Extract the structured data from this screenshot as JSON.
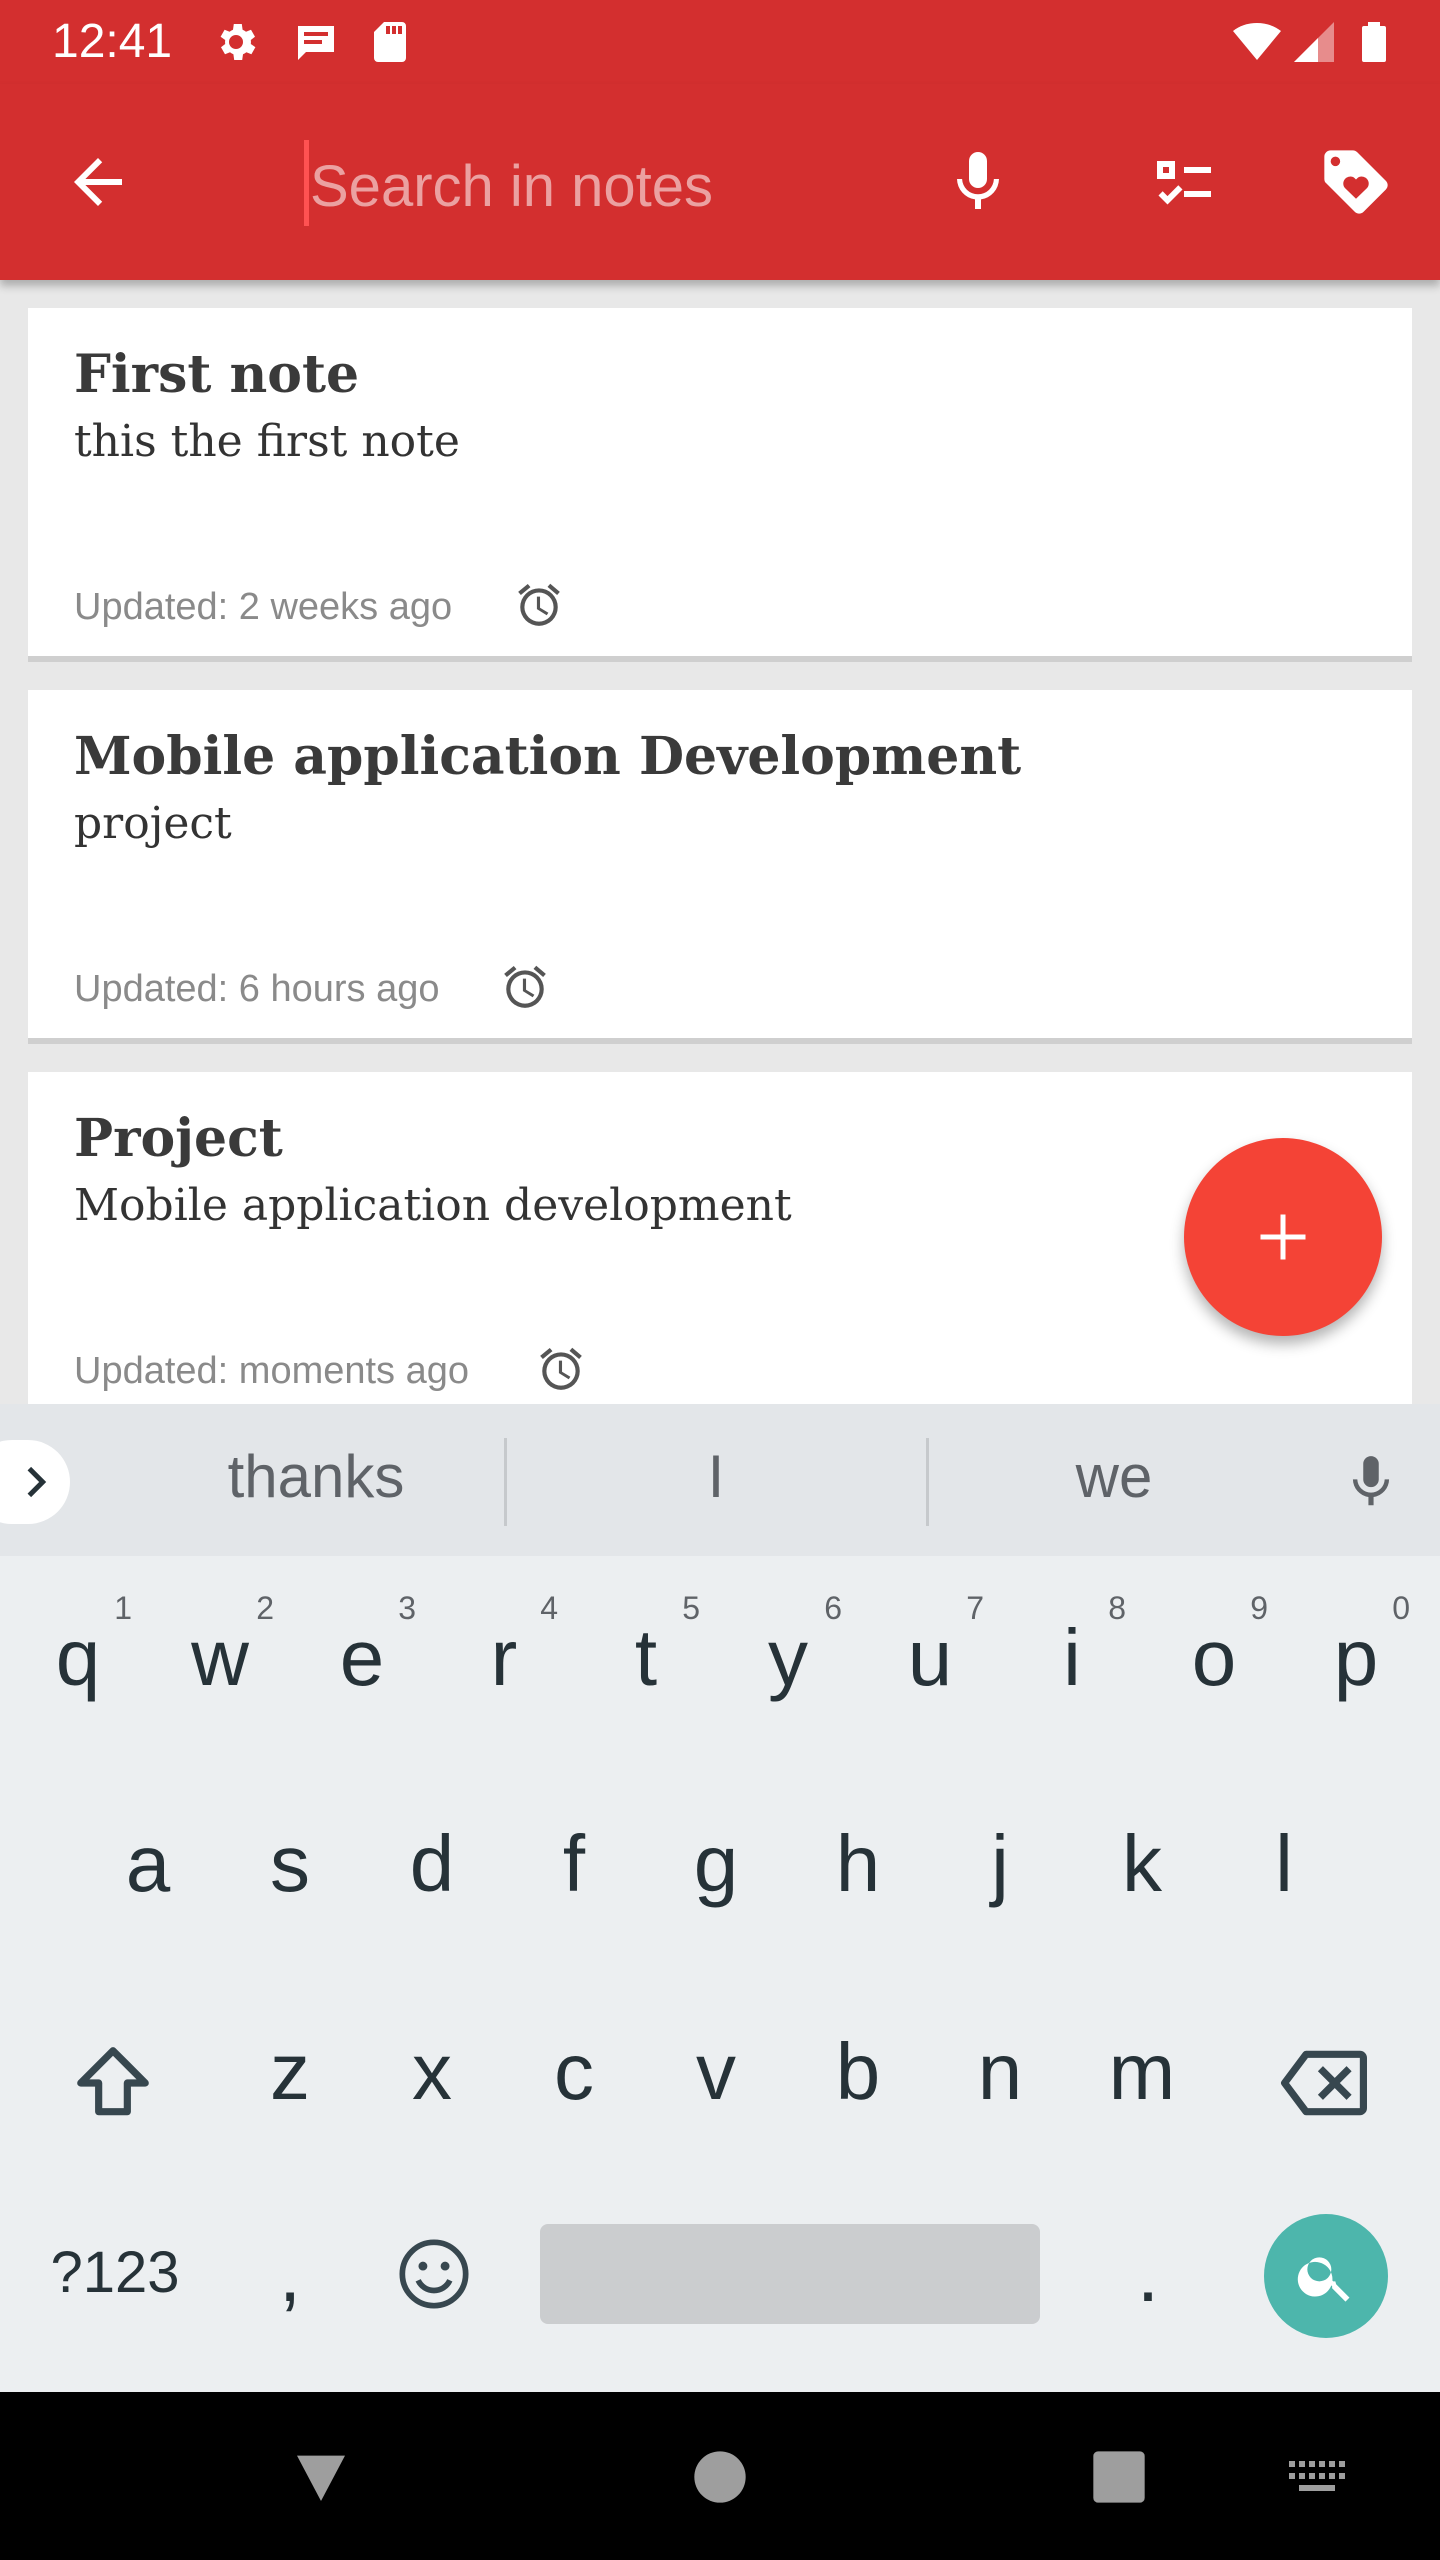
{
  "status_bar": {
    "time": "12:41",
    "left_icons": [
      "gear-icon",
      "message-icon",
      "sd-card-icon"
    ],
    "right_icons": [
      "wifi-icon",
      "signal-icon",
      "battery-icon"
    ]
  },
  "app_bar": {
    "color": "#d32f2f",
    "search_placeholder": "Search in notes",
    "search_value": "",
    "icons": [
      "back-arrow-icon",
      "microphone-icon",
      "checklist-icon",
      "tag-icon"
    ]
  },
  "notes": [
    {
      "title": "First note",
      "body": "this the first note",
      "updated": "Updated: 2 weeks ago"
    },
    {
      "title": "Mobile application Development",
      "body": "project",
      "updated": "Updated: 6 hours ago"
    },
    {
      "title": "Project",
      "body": "Mobile application development",
      "updated": "Updated: moments ago"
    }
  ],
  "fab": {
    "icon": "plus-icon",
    "color": "#f44336"
  },
  "keyboard": {
    "suggestions": [
      "thanks",
      "I",
      "we"
    ],
    "row1": [
      {
        "ch": "q",
        "hint": "1"
      },
      {
        "ch": "w",
        "hint": "2"
      },
      {
        "ch": "e",
        "hint": "3"
      },
      {
        "ch": "r",
        "hint": "4"
      },
      {
        "ch": "t",
        "hint": "5"
      },
      {
        "ch": "y",
        "hint": "6"
      },
      {
        "ch": "u",
        "hint": "7"
      },
      {
        "ch": "i",
        "hint": "8"
      },
      {
        "ch": "o",
        "hint": "9"
      },
      {
        "ch": "p",
        "hint": "0"
      }
    ],
    "row2": [
      "a",
      "s",
      "d",
      "f",
      "g",
      "h",
      "j",
      "k",
      "l"
    ],
    "row3": [
      "z",
      "x",
      "c",
      "v",
      "b",
      "n",
      "m"
    ],
    "symbols_label": "?123",
    "comma": ",",
    "period": ".",
    "action_color": "#4db6ac"
  },
  "nav_bar": {
    "icons": [
      "back-triangle-icon",
      "home-circle-icon",
      "recents-square-icon",
      "keyboard-switch-icon"
    ]
  }
}
